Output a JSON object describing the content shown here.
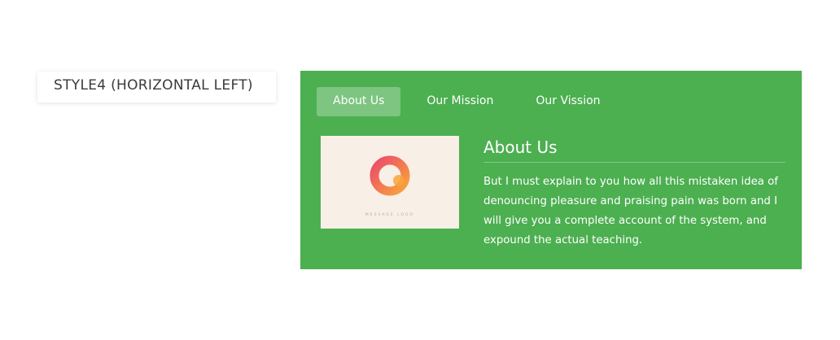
{
  "style_label": "STYLE4 (HORIZONTAL LEFT)",
  "tabs": [
    {
      "label": "About Us",
      "active": true
    },
    {
      "label": "Our Mission",
      "active": false
    },
    {
      "label": "Our Vission",
      "active": false
    }
  ],
  "content": {
    "title": "About Us",
    "body": "But I must explain to you how all this mistaken idea of denouncing pleasure and praising pain was born and I will give you a complete account of the system, and expound the actual teaching."
  },
  "image": {
    "caption": "MESSAGE LOGO"
  },
  "colors": {
    "panel_background": "#4caf50",
    "tab_active_background": "rgba(255,255,255,0.28)",
    "text": "#ffffff",
    "image_background": "#f8efe7",
    "logo_pink": "#ec4a6a",
    "logo_orange": "#f7a53a"
  }
}
